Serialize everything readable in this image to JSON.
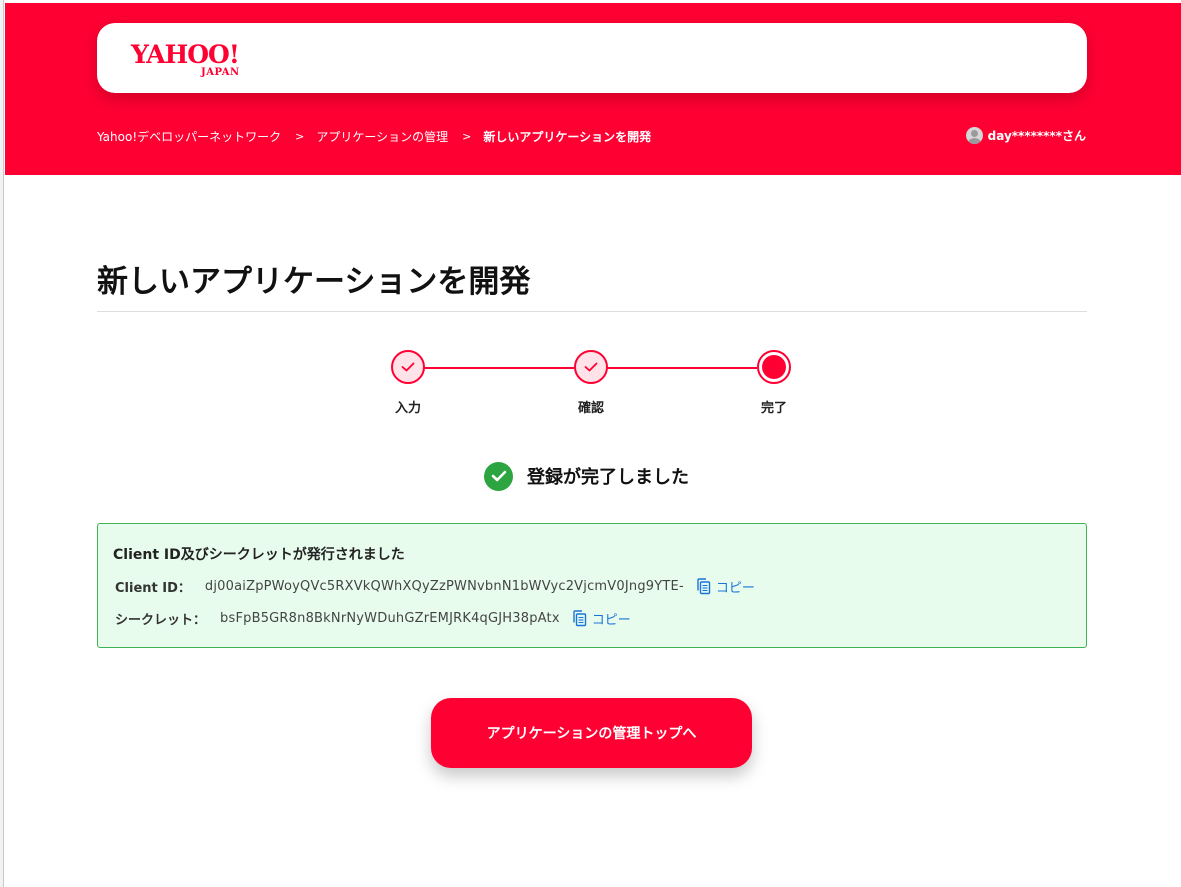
{
  "header": {
    "logo_main": "YAHOO!",
    "logo_sub": "JAPAN",
    "breadcrumb": [
      {
        "label": "Yahoo!デベロッパーネットワーク"
      },
      {
        "label": "アプリケーションの管理"
      },
      {
        "label": "新しいアプリケーションを開発"
      }
    ],
    "separator": ">",
    "user_name": "day********さん"
  },
  "page": {
    "title": "新しいアプリケーションを開発"
  },
  "steps": [
    {
      "label": "入力",
      "state": "done"
    },
    {
      "label": "確認",
      "state": "done"
    },
    {
      "label": "完了",
      "state": "active"
    }
  ],
  "complete_message": "登録が完了しました",
  "credentials": {
    "title": "Client ID及びシークレットが発行されました",
    "client_id_label": "Client ID：",
    "client_id_value": "dj00aiZpPWoyQVc5RXVkQWhXQyZzPWNvbnN1bWVyc2VjcmV0Jng9YTE-",
    "secret_label": "シークレット：",
    "secret_value": "bsFpB5GR8n8BkNrNyWDuhGZrEMJRK4qGJH38pAtx",
    "copy_label": "コピー"
  },
  "actions": {
    "back_to_top": "アプリケーションの管理トップへ"
  },
  "colors": {
    "brand": "#ff0033",
    "success": "#2ca43f",
    "success_bg": "#e8fcee",
    "link": "#1a73d9"
  }
}
